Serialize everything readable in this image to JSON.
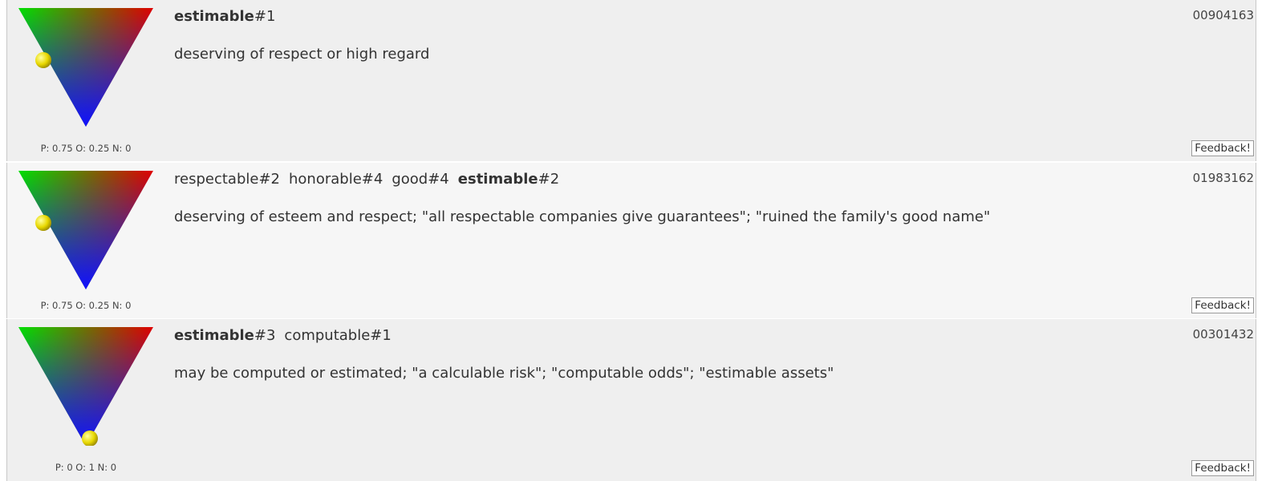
{
  "entries": [
    {
      "terms": [
        {
          "word": "estimable",
          "sense": "#1",
          "bold": true
        }
      ],
      "gloss": "deserving of respect or high regard",
      "synset_id": "00904163",
      "scores": {
        "P": 0.75,
        "O": 0.25,
        "N": 0
      },
      "score_label": "P: 0.75 O: 0.25 N: 0",
      "feedback_label": "Feedback!"
    },
    {
      "terms": [
        {
          "word": "respectable",
          "sense": "#2",
          "bold": false
        },
        {
          "word": "honorable",
          "sense": "#4",
          "bold": false
        },
        {
          "word": "good",
          "sense": "#4",
          "bold": false
        },
        {
          "word": "estimable",
          "sense": "#2",
          "bold": true
        }
      ],
      "gloss": "deserving of esteem and respect; \"all respectable companies give guarantees\"; \"ruined the family's good name\"",
      "synset_id": "01983162",
      "scores": {
        "P": 0.75,
        "O": 0.25,
        "N": 0
      },
      "score_label": "P: 0.75 O: 0.25 N: 0",
      "feedback_label": "Feedback!"
    },
    {
      "terms": [
        {
          "word": "estimable",
          "sense": "#3",
          "bold": true
        },
        {
          "word": "computable",
          "sense": "#1",
          "bold": false
        }
      ],
      "gloss": "may be computed or estimated; \"a calculable risk\"; \"computable odds\"; \"estimable assets\"",
      "synset_id": "00301432",
      "scores": {
        "P": 0,
        "O": 1,
        "N": 0
      },
      "score_label": "P: 0 O: 1 N: 0",
      "feedback_label": "Feedback!"
    }
  ],
  "colors": {
    "positive_corner": "#00e000",
    "negative_corner": "#e00000",
    "objective_corner": "#1010ff",
    "marker": "#e8d800"
  }
}
